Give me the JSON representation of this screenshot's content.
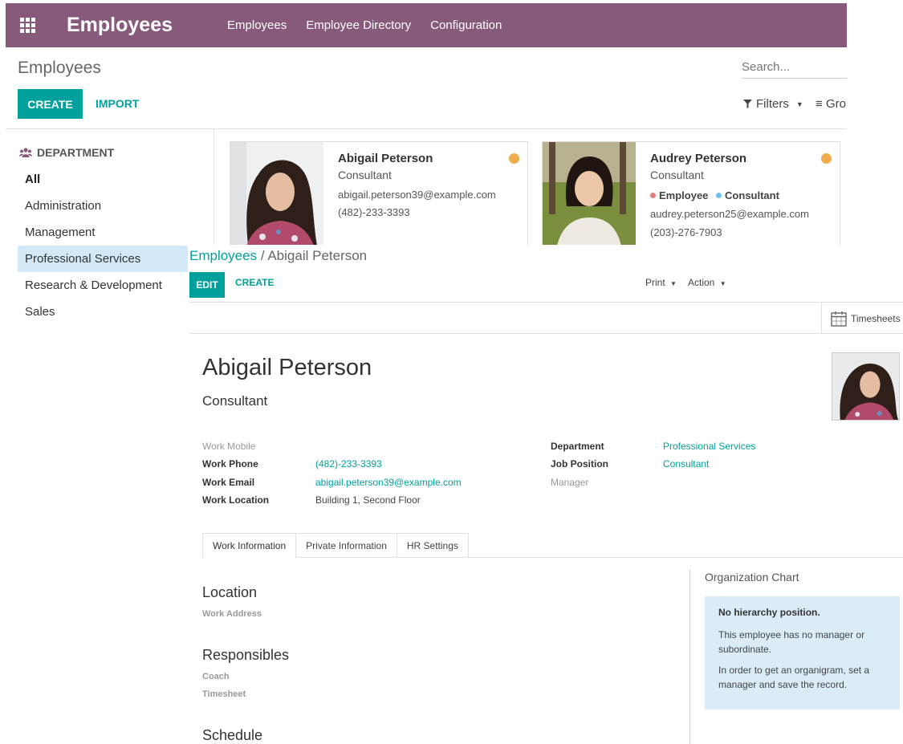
{
  "topbar": {
    "app_title": "Employees",
    "menu": [
      "Employees",
      "Employee Directory",
      "Configuration"
    ],
    "color": "#875a7b"
  },
  "kanban": {
    "title": "Employees",
    "search_placeholder": "Search...",
    "create_label": "CREATE",
    "import_label": "IMPORT",
    "filters_label": "Filters",
    "groupby_label": "Group By",
    "department_header": "DEPARTMENT",
    "departments": [
      "All",
      "Administration",
      "Management",
      "Professional Services",
      "Research & Development",
      "Sales"
    ],
    "selected_department": "Professional Services",
    "cards": [
      {
        "name": "Abigail Peterson",
        "job": "Consultant",
        "email": "abigail.peterson39@example.com",
        "phone": "(482)-233-3393",
        "status_color": "#f0ad4e"
      },
      {
        "name": "Audrey Peterson",
        "job": "Consultant",
        "tags": [
          "Employee",
          "Consultant"
        ],
        "email": "audrey.peterson25@example.com",
        "phone": "(203)-276-7903",
        "status_color": "#f0ad4e"
      }
    ]
  },
  "form": {
    "breadcrumb_parent": "Employees",
    "breadcrumb_sep": " / ",
    "breadcrumb_current": "Abigail Peterson",
    "edit_label": "EDIT",
    "create_label": "CREATE",
    "print_label": "Print",
    "action_label": "Action",
    "timesheets_label": "Timesheets",
    "employee_name": "Abigail Peterson",
    "job_title": "Consultant",
    "fields_left": {
      "work_mobile_label": "Work Mobile",
      "work_phone_label": "Work Phone",
      "work_phone": "(482)-233-3393",
      "work_email_label": "Work Email",
      "work_email": "abigail.peterson39@example.com",
      "work_location_label": "Work Location",
      "work_location": "Building 1, Second Floor"
    },
    "fields_right": {
      "department_label": "Department",
      "department": "Professional Services",
      "job_position_label": "Job Position",
      "job_position": "Consultant",
      "manager_label": "Manager"
    },
    "tabs": [
      "Work Information",
      "Private Information",
      "HR Settings"
    ],
    "location_title": "Location",
    "work_address_label": "Work Address",
    "responsibles_title": "Responsibles",
    "coach_label": "Coach",
    "timesheet_label": "Timesheet",
    "schedule_title": "Schedule",
    "org_chart": {
      "title": "Organization Chart",
      "heading": "No hierarchy position.",
      "text1": "This employee has no manager or subordinate.",
      "text2": "In order to get an organigram, set a manager and save the record."
    }
  }
}
